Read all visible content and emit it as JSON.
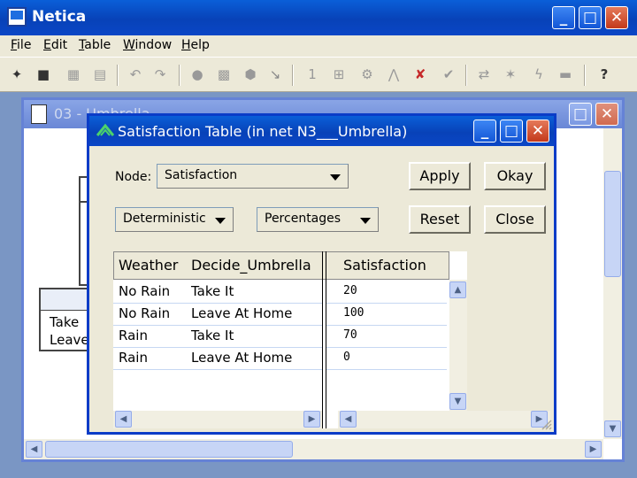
{
  "app": {
    "title": "Netica"
  },
  "menu": [
    {
      "label": "File",
      "mnemonic": "F"
    },
    {
      "label": "Edit",
      "mnemonic": "E"
    },
    {
      "label": "Table",
      "mnemonic": "T"
    },
    {
      "label": "Window",
      "mnemonic": "W"
    },
    {
      "label": "Help",
      "mnemonic": "H"
    }
  ],
  "caption_buttons": {
    "minimize": "_",
    "maximize": "□",
    "close": "✕"
  },
  "net_window": {
    "title": "03 - Umbrella",
    "node_partial": {
      "rows": [
        "Take",
        "Leave"
      ]
    }
  },
  "dialog": {
    "title": "Satisfaction Table (in net N3___Umbrella)",
    "node_label": "Node:",
    "node_value": "Satisfaction",
    "function_select": "Deterministic",
    "format_select": "Percentages",
    "buttons": {
      "apply": "Apply",
      "okay": "Okay",
      "reset": "Reset",
      "close": "Close"
    },
    "table": {
      "headers": [
        "Weather",
        "Decide_Umbrella",
        "Satisfaction"
      ],
      "rows": [
        {
          "weather": "No Rain",
          "decide": "Take It",
          "satisfaction": "20"
        },
        {
          "weather": "No Rain",
          "decide": "Leave At Home",
          "satisfaction": "100"
        },
        {
          "weather": "Rain",
          "decide": "Take It",
          "satisfaction": "70"
        },
        {
          "weather": "Rain",
          "decide": "Leave At Home",
          "satisfaction": "0"
        }
      ]
    }
  },
  "toolbar_icons": [
    "new-icon",
    "save-icon",
    "print-icon",
    "copy-icon",
    "undo-icon",
    "redo-icon",
    "nature-node-icon",
    "decision-node-icon",
    "utility-node-icon",
    "link-icon",
    "compile-icon",
    "network-icon",
    "run-icon",
    "absorb-icon",
    "uncompile-icon",
    "check-icon",
    "reverse-link-icon",
    "bayes-icon",
    "lightning-icon",
    "table-icon",
    "help-icon"
  ],
  "colors": {
    "title_blue": "#0a46c6",
    "close_red": "#c3391b",
    "mdi_bg": "#7a96c4",
    "face": "#ece9d8"
  }
}
